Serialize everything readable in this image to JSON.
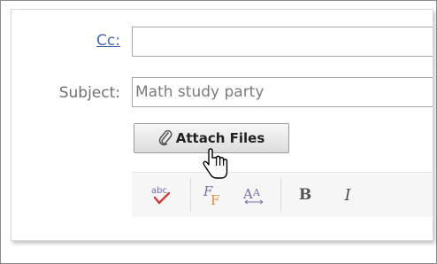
{
  "compose": {
    "cc_label": "Cc:",
    "cc_value": "",
    "subject_label": "Subject:",
    "subject_value": "Math study party",
    "attach_label": "Attach Files"
  },
  "toolbar": {
    "buttons": [
      "spell-check-icon",
      "font-color-icon",
      "font-size-icon",
      "bold-icon",
      "italic-icon"
    ],
    "bold_label": "B",
    "italic_label": "I"
  },
  "colors": {
    "link": "#4a68b8",
    "label": "#6f6f6f",
    "spell_red": "#d23a3a",
    "font_orange": "#e58a3a"
  }
}
